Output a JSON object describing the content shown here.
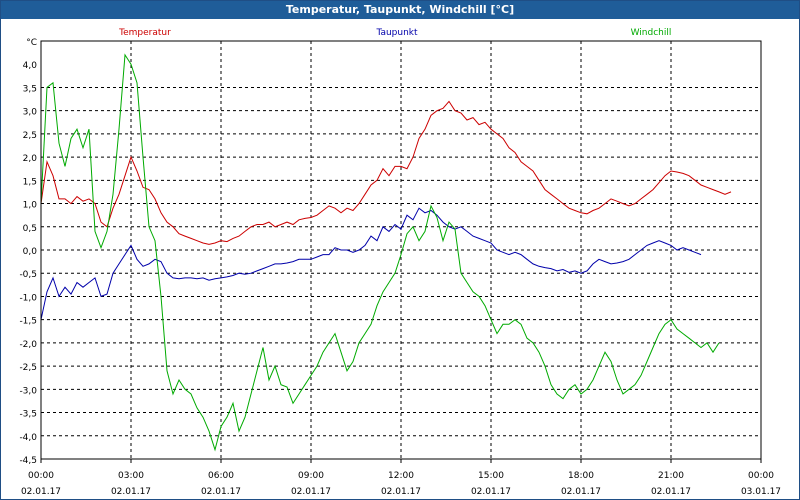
{
  "window": {
    "title": "Temperatur, Taupunkt, Windchill [°C]"
  },
  "chart_data": {
    "type": "line",
    "title": "Temperatur, Taupunkt, Windchill [°C]",
    "ylabel": "°C",
    "ylim": [
      -4.5,
      4.5
    ],
    "yticks": [
      4.0,
      3.5,
      3.0,
      2.5,
      2.0,
      1.5,
      1.0,
      0.5,
      0.0,
      -0.5,
      -1.0,
      -1.5,
      -2.0,
      -2.5,
      -3.0,
      -3.5,
      -4.0,
      -4.5
    ],
    "ytick_labels": [
      "4,0",
      "3,5",
      "3,0",
      "2,5",
      "2,0",
      "1,5",
      "1,0",
      "0,5",
      "0,0",
      "-0,5",
      "-1,0",
      "-1,5",
      "-2,0",
      "-2,5",
      "-3,0",
      "-3,5",
      "-4,0",
      "-4,5"
    ],
    "xlim": [
      0,
      24
    ],
    "xticks": [
      {
        "time": "00:00",
        "date": "02.01.17"
      },
      {
        "time": "03:00",
        "date": "02.01.17"
      },
      {
        "time": "06:00",
        "date": "02.01.17"
      },
      {
        "time": "09:00",
        "date": "02.01.17"
      },
      {
        "time": "12:00",
        "date": "02.01.17"
      },
      {
        "time": "15:00",
        "date": "02.01.17"
      },
      {
        "time": "18:00",
        "date": "02.01.17"
      },
      {
        "time": "21:00",
        "date": "02.01.17"
      },
      {
        "time": "00:00",
        "date": "03.01.17"
      }
    ],
    "grid": true,
    "legend": "top",
    "x_hours": [
      0,
      0.2,
      0.4,
      0.6,
      0.8,
      1,
      1.2,
      1.4,
      1.6,
      1.8,
      2,
      2.2,
      2.4,
      2.6,
      2.8,
      3,
      3.2,
      3.4,
      3.6,
      3.8,
      4,
      4.2,
      4.4,
      4.6,
      4.8,
      5,
      5.2,
      5.4,
      5.6,
      5.8,
      6,
      6.2,
      6.4,
      6.6,
      6.8,
      7,
      7.2,
      7.4,
      7.6,
      7.8,
      8,
      8.2,
      8.4,
      8.6,
      8.8,
      9,
      9.2,
      9.4,
      9.6,
      9.8,
      10,
      10.2,
      10.4,
      10.6,
      10.8,
      11,
      11.2,
      11.4,
      11.6,
      11.8,
      12,
      12.2,
      12.4,
      12.6,
      12.8,
      13,
      13.2,
      13.4,
      13.6,
      13.8,
      14,
      14.2,
      14.4,
      14.6,
      14.8,
      15,
      15.2,
      15.4,
      15.6,
      15.8,
      16,
      16.2,
      16.4,
      16.6,
      16.8,
      17,
      17.2,
      17.4,
      17.6,
      17.8,
      18,
      18.2,
      18.4,
      18.6,
      18.8,
      19,
      19.2,
      19.4,
      19.6,
      19.8,
      20,
      20.2,
      20.4,
      20.6,
      20.8,
      21,
      21.2,
      21.4,
      21.6,
      21.8,
      22,
      22.2,
      22.4,
      22.6,
      22.8,
      23,
      23.2,
      23.4,
      23.6,
      23.8,
      24
    ],
    "series": [
      {
        "name": "Temperatur",
        "color": "#cc0000",
        "values": [
          1.0,
          1.9,
          1.6,
          1.1,
          1.1,
          1.0,
          1.15,
          1.05,
          1.1,
          1.0,
          0.6,
          0.5,
          0.9,
          1.2,
          1.6,
          2.0,
          1.7,
          1.35,
          1.3,
          1.1,
          0.8,
          0.6,
          0.5,
          0.35,
          0.3,
          0.25,
          0.2,
          0.15,
          0.12,
          0.15,
          0.2,
          0.18,
          0.25,
          0.3,
          0.4,
          0.5,
          0.55,
          0.55,
          0.6,
          0.5,
          0.55,
          0.6,
          0.55,
          0.65,
          0.68,
          0.7,
          0.75,
          0.85,
          0.95,
          0.9,
          0.8,
          0.9,
          0.85,
          1.0,
          1.2,
          1.4,
          1.5,
          1.75,
          1.6,
          1.8,
          1.8,
          1.75,
          2.0,
          2.4,
          2.6,
          2.9,
          3.0,
          3.05,
          3.2,
          3.0,
          2.95,
          2.8,
          2.85,
          2.7,
          2.75,
          2.6,
          2.5,
          2.4,
          2.2,
          2.1,
          1.9,
          1.8,
          1.7,
          1.5,
          1.3,
          1.2,
          1.1,
          1.0,
          0.9,
          0.85,
          0.8,
          0.78,
          0.85,
          0.9,
          1.0,
          1.1,
          1.05,
          1.0,
          0.95,
          1.0,
          1.1,
          1.2,
          1.3,
          1.45,
          1.6,
          1.7,
          1.68,
          1.65,
          1.6,
          1.5,
          1.4,
          1.35,
          1.3,
          1.25,
          1.2,
          1.25
        ]
      },
      {
        "name": "Taupunkt",
        "color": "#0000aa",
        "values": [
          -1.5,
          -0.9,
          -0.6,
          -1.0,
          -0.8,
          -0.95,
          -0.7,
          -0.8,
          -0.7,
          -0.6,
          -1.0,
          -0.95,
          -0.5,
          -0.3,
          -0.1,
          0.1,
          -0.2,
          -0.35,
          -0.3,
          -0.2,
          -0.25,
          -0.5,
          -0.6,
          -0.62,
          -0.6,
          -0.6,
          -0.62,
          -0.6,
          -0.65,
          -0.62,
          -0.6,
          -0.58,
          -0.55,
          -0.5,
          -0.52,
          -0.5,
          -0.45,
          -0.4,
          -0.35,
          -0.3,
          -0.3,
          -0.28,
          -0.25,
          -0.2,
          -0.2,
          -0.2,
          -0.15,
          -0.1,
          -0.1,
          0.05,
          0.0,
          0.0,
          -0.05,
          0.0,
          0.1,
          0.3,
          0.2,
          0.5,
          0.4,
          0.55,
          0.45,
          0.75,
          0.65,
          0.9,
          0.8,
          0.85,
          0.75,
          0.6,
          0.5,
          0.45,
          0.5,
          0.4,
          0.3,
          0.25,
          0.2,
          0.15,
          0.0,
          -0.05,
          -0.1,
          -0.05,
          -0.1,
          -0.2,
          -0.3,
          -0.35,
          -0.38,
          -0.4,
          -0.45,
          -0.42,
          -0.48,
          -0.45,
          -0.5,
          -0.45,
          -0.3,
          -0.2,
          -0.25,
          -0.3,
          -0.28,
          -0.25,
          -0.2,
          -0.1,
          0.0,
          0.1,
          0.15,
          0.2,
          0.15,
          0.1,
          0.0,
          0.05,
          0.0,
          -0.05,
          -0.1
        ]
      },
      {
        "name": "Windchill",
        "color": "#00aa00",
        "values": [
          1.0,
          3.5,
          3.6,
          2.3,
          1.8,
          2.4,
          2.6,
          2.2,
          2.6,
          0.4,
          0.05,
          0.4,
          1.2,
          2.6,
          4.2,
          4.0,
          3.6,
          2.0,
          0.5,
          0.2,
          -1.0,
          -2.6,
          -3.1,
          -2.8,
          -3.0,
          -3.1,
          -3.4,
          -3.6,
          -3.9,
          -4.3,
          -3.8,
          -3.6,
          -3.3,
          -3.9,
          -3.6,
          -3.1,
          -2.6,
          -2.1,
          -2.8,
          -2.5,
          -2.9,
          -2.95,
          -3.3,
          -3.1,
          -2.9,
          -2.7,
          -2.5,
          -2.2,
          -2.0,
          -1.8,
          -2.2,
          -2.6,
          -2.4,
          -2.0,
          -1.8,
          -1.6,
          -1.2,
          -0.9,
          -0.7,
          -0.5,
          -0.1,
          0.35,
          0.5,
          0.2,
          0.4,
          0.95,
          0.7,
          0.2,
          0.6,
          0.45,
          -0.5,
          -0.7,
          -0.9,
          -1.0,
          -1.2,
          -1.5,
          -1.8,
          -1.6,
          -1.6,
          -1.5,
          -1.6,
          -1.9,
          -2.0,
          -2.2,
          -2.5,
          -2.9,
          -3.1,
          -3.2,
          -3.0,
          -2.9,
          -3.1,
          -3.0,
          -2.8,
          -2.5,
          -2.2,
          -2.4,
          -2.8,
          -3.1,
          -3.0,
          -2.9,
          -2.7,
          -2.4,
          -2.1,
          -1.8,
          -1.6,
          -1.5,
          -1.7,
          -1.8,
          -1.9,
          -2.0,
          -2.1,
          -2.0,
          -2.2,
          -2.0
        ]
      }
    ]
  }
}
